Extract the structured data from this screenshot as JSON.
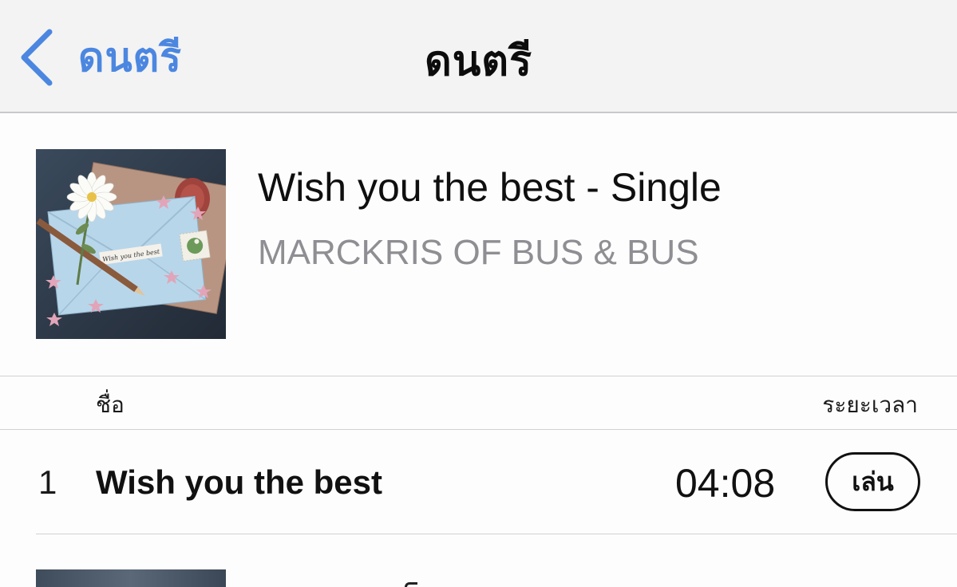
{
  "nav": {
    "back_label": "ดนตรี",
    "title": "ดนตรี"
  },
  "album": {
    "title": "Wish you the best - Single",
    "artist": "MARCKRIS OF BUS & BUS",
    "artwork_text": "Wish you the best",
    "artwork_icon": "album-artwork"
  },
  "list_header": {
    "name_label": "ชื่อ",
    "duration_label": "ระยะเวลา"
  },
  "tracks": [
    {
      "number": "1",
      "title": "Wish you the best",
      "duration": "04:08",
      "play_label": "เล่น"
    }
  ],
  "colors": {
    "accent": "#4b87e0",
    "nav_background": "#f3f3f3",
    "secondary_text": "#8e8e93",
    "separator": "#d1d1d6"
  }
}
